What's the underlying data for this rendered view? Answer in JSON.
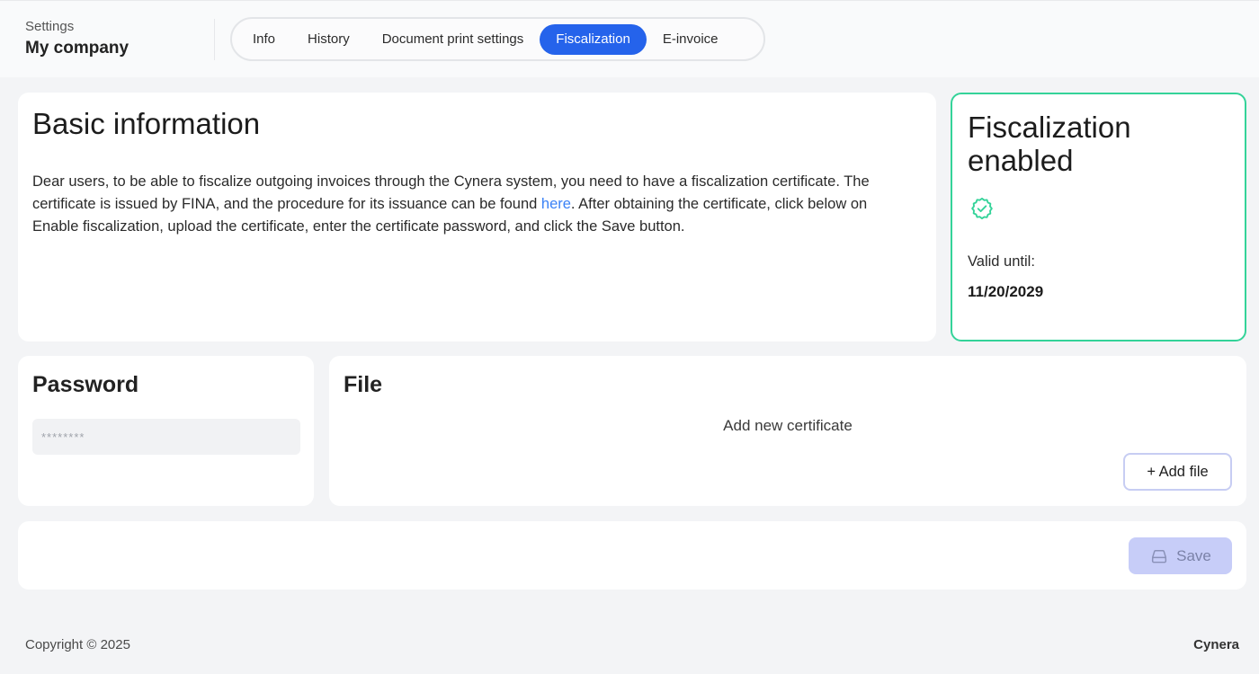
{
  "header": {
    "breadcrumb_small": "Settings",
    "title": "My company",
    "tabs": [
      {
        "label": "Info",
        "active": false
      },
      {
        "label": "History",
        "active": false
      },
      {
        "label": "Document print settings",
        "active": false
      },
      {
        "label": "Fiscalization",
        "active": true
      },
      {
        "label": "E-invoice",
        "active": false
      }
    ]
  },
  "basic_info": {
    "heading": "Basic information",
    "text_before_link": "Dear users, to be able to fiscalize outgoing invoices through the Cynera system, you need to have a fiscalization certificate. The certificate is issued by FINA, and the procedure for its issuance can be found ",
    "link_text": "here",
    "text_after_link": ". After obtaining the certificate, click below on Enable fiscalization, upload the certificate, enter the certificate password, and click the Save button."
  },
  "status": {
    "title": "Fiscalization enabled",
    "icon": "verified-badge-icon",
    "valid_label": "Valid until:",
    "valid_date": "11/20/2029"
  },
  "password": {
    "heading": "Password",
    "placeholder": "********"
  },
  "file": {
    "heading": "File",
    "hint": "Add new certificate",
    "add_button": "+ Add file"
  },
  "save": {
    "label": "Save",
    "icon": "drive-icon"
  },
  "footer": {
    "copyright": "Copyright © 2025",
    "brand": "Cynera"
  },
  "colors": {
    "accent": "#2563eb",
    "success": "#34d399",
    "link": "#3b82f6",
    "save_disabled_bg": "#c7cdf8"
  }
}
